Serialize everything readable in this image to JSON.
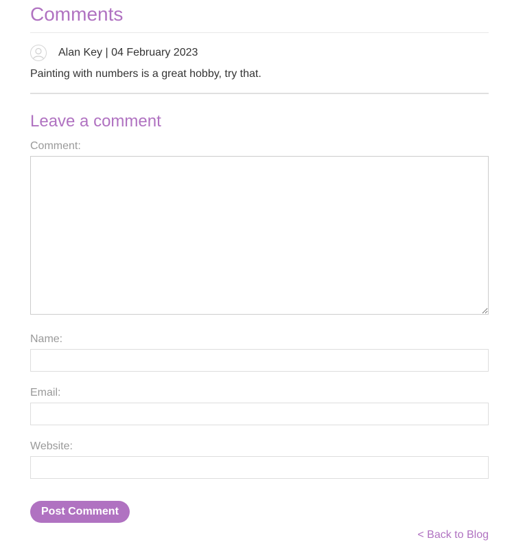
{
  "comments_section": {
    "title": "Comments",
    "comments": [
      {
        "author_line": "Alan Key | 04 February 2023",
        "avatar_icon": "user-avatar-icon",
        "body": "Painting with numbers is a great hobby, try that."
      }
    ]
  },
  "comment_form": {
    "title": "Leave a comment",
    "comment_label": "Comment:",
    "comment_value": "",
    "name_label": "Name:",
    "name_value": "",
    "email_label": "Email:",
    "email_value": "",
    "website_label": "Website:",
    "website_value": "",
    "submit_label": "Post Comment"
  },
  "back_link": {
    "label": "< Back to Blog"
  },
  "colors": {
    "accent": "#b072c1",
    "text": "#333333",
    "label": "#999999"
  }
}
